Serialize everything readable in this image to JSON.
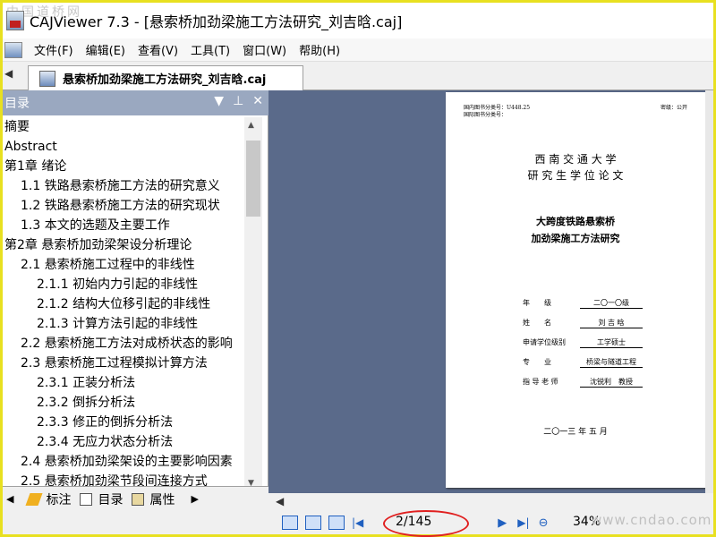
{
  "watermark_top": "中国道桥网",
  "window": {
    "title": "CAJViewer 7.3 - [悬索桥加劲梁施工方法研究_刘吉晗.caj]"
  },
  "menu": [
    "文件(F)",
    "编辑(E)",
    "查看(V)",
    "工具(T)",
    "窗口(W)",
    "帮助(H)"
  ],
  "doc_tab": {
    "label": "悬索桥加劲梁施工方法研究_刘吉晗.caj"
  },
  "toc": {
    "title": "目录",
    "items": [
      "摘要",
      "Abstract",
      "第1章 绪论",
      "1.1 铁路悬索桥施工方法的研究意义",
      "1.2 铁路悬索桥施工方法的研究现状",
      "1.3 本文的选题及主要工作",
      "第2章 悬索桥加劲梁架设分析理论",
      "2.1 悬索桥施工过程中的非线性",
      "2.1.1 初始内力引起的非线性",
      "2.1.2 结构大位移引起的非线性",
      "2.1.3 计算方法引起的非线性",
      "2.2 悬索桥施工方法对成桥状态的影响",
      "2.3 悬索桥施工过程模拟计算方法",
      "2.3.1 正装分析法",
      "2.3.2 倒拆分析法",
      "2.3.3 修正的倒拆分析法",
      "2.3.4 无应力状态分析法",
      "2.4 悬索桥加劲梁架设的主要影响因素",
      "2.5 悬索桥加劲梁节段间连接方式"
    ],
    "tabs": [
      "标注",
      "目录",
      "属性"
    ]
  },
  "document_page": {
    "class_domestic": "国内图书分类号：U448.25",
    "class_intl": "国际图书分类号：",
    "secrecy": "密级：公开",
    "university": "西 南 交 通 大 学",
    "thesis_type": "研 究 生 学 位 论 文",
    "title_line1": "大跨度铁路悬索桥",
    "title_line2": "加劲梁施工方法研究",
    "fields": [
      {
        "label": "年　　级",
        "value": "二〇一〇级"
      },
      {
        "label": "姓　　名",
        "value": "刘 吉 晗"
      },
      {
        "label": "申请学位级别",
        "value": "工学硕士"
      },
      {
        "label": "专　　业",
        "value": "桥梁与隧道工程"
      },
      {
        "label": "指 导 老 师",
        "value": "沈锐利　教授"
      }
    ],
    "date": "二〇一三 年 五 月"
  },
  "status": {
    "page": "2/145",
    "zoom": "34%"
  },
  "watermark_bottom": "www.cndao.com"
}
